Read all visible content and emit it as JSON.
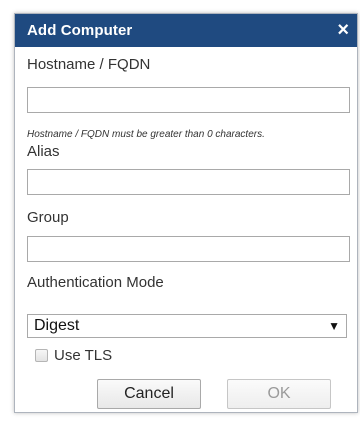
{
  "dialog": {
    "title": "Add Computer",
    "close_symbol": "×",
    "titlebar_color": "#1f4a80"
  },
  "form": {
    "hostname_label": "Hostname / FQDN",
    "hostname_value": "",
    "hostname_hint": "Hostname / FQDN must be greater than 0 characters.",
    "alias_label": "Alias",
    "alias_value": "",
    "group_label": "Group",
    "group_value": "",
    "auth_label": "Authentication Mode",
    "auth_value": "Digest",
    "auth_arrow": "▼",
    "tls_label": "Use TLS",
    "tls_checked": false
  },
  "buttons": {
    "cancel_label": "Cancel",
    "ok_label": "OK",
    "ok_enabled": false
  },
  "icons": {
    "close": "close-icon",
    "dropdown": "chevron-down-icon",
    "checkbox": "checkbox-unchecked"
  }
}
